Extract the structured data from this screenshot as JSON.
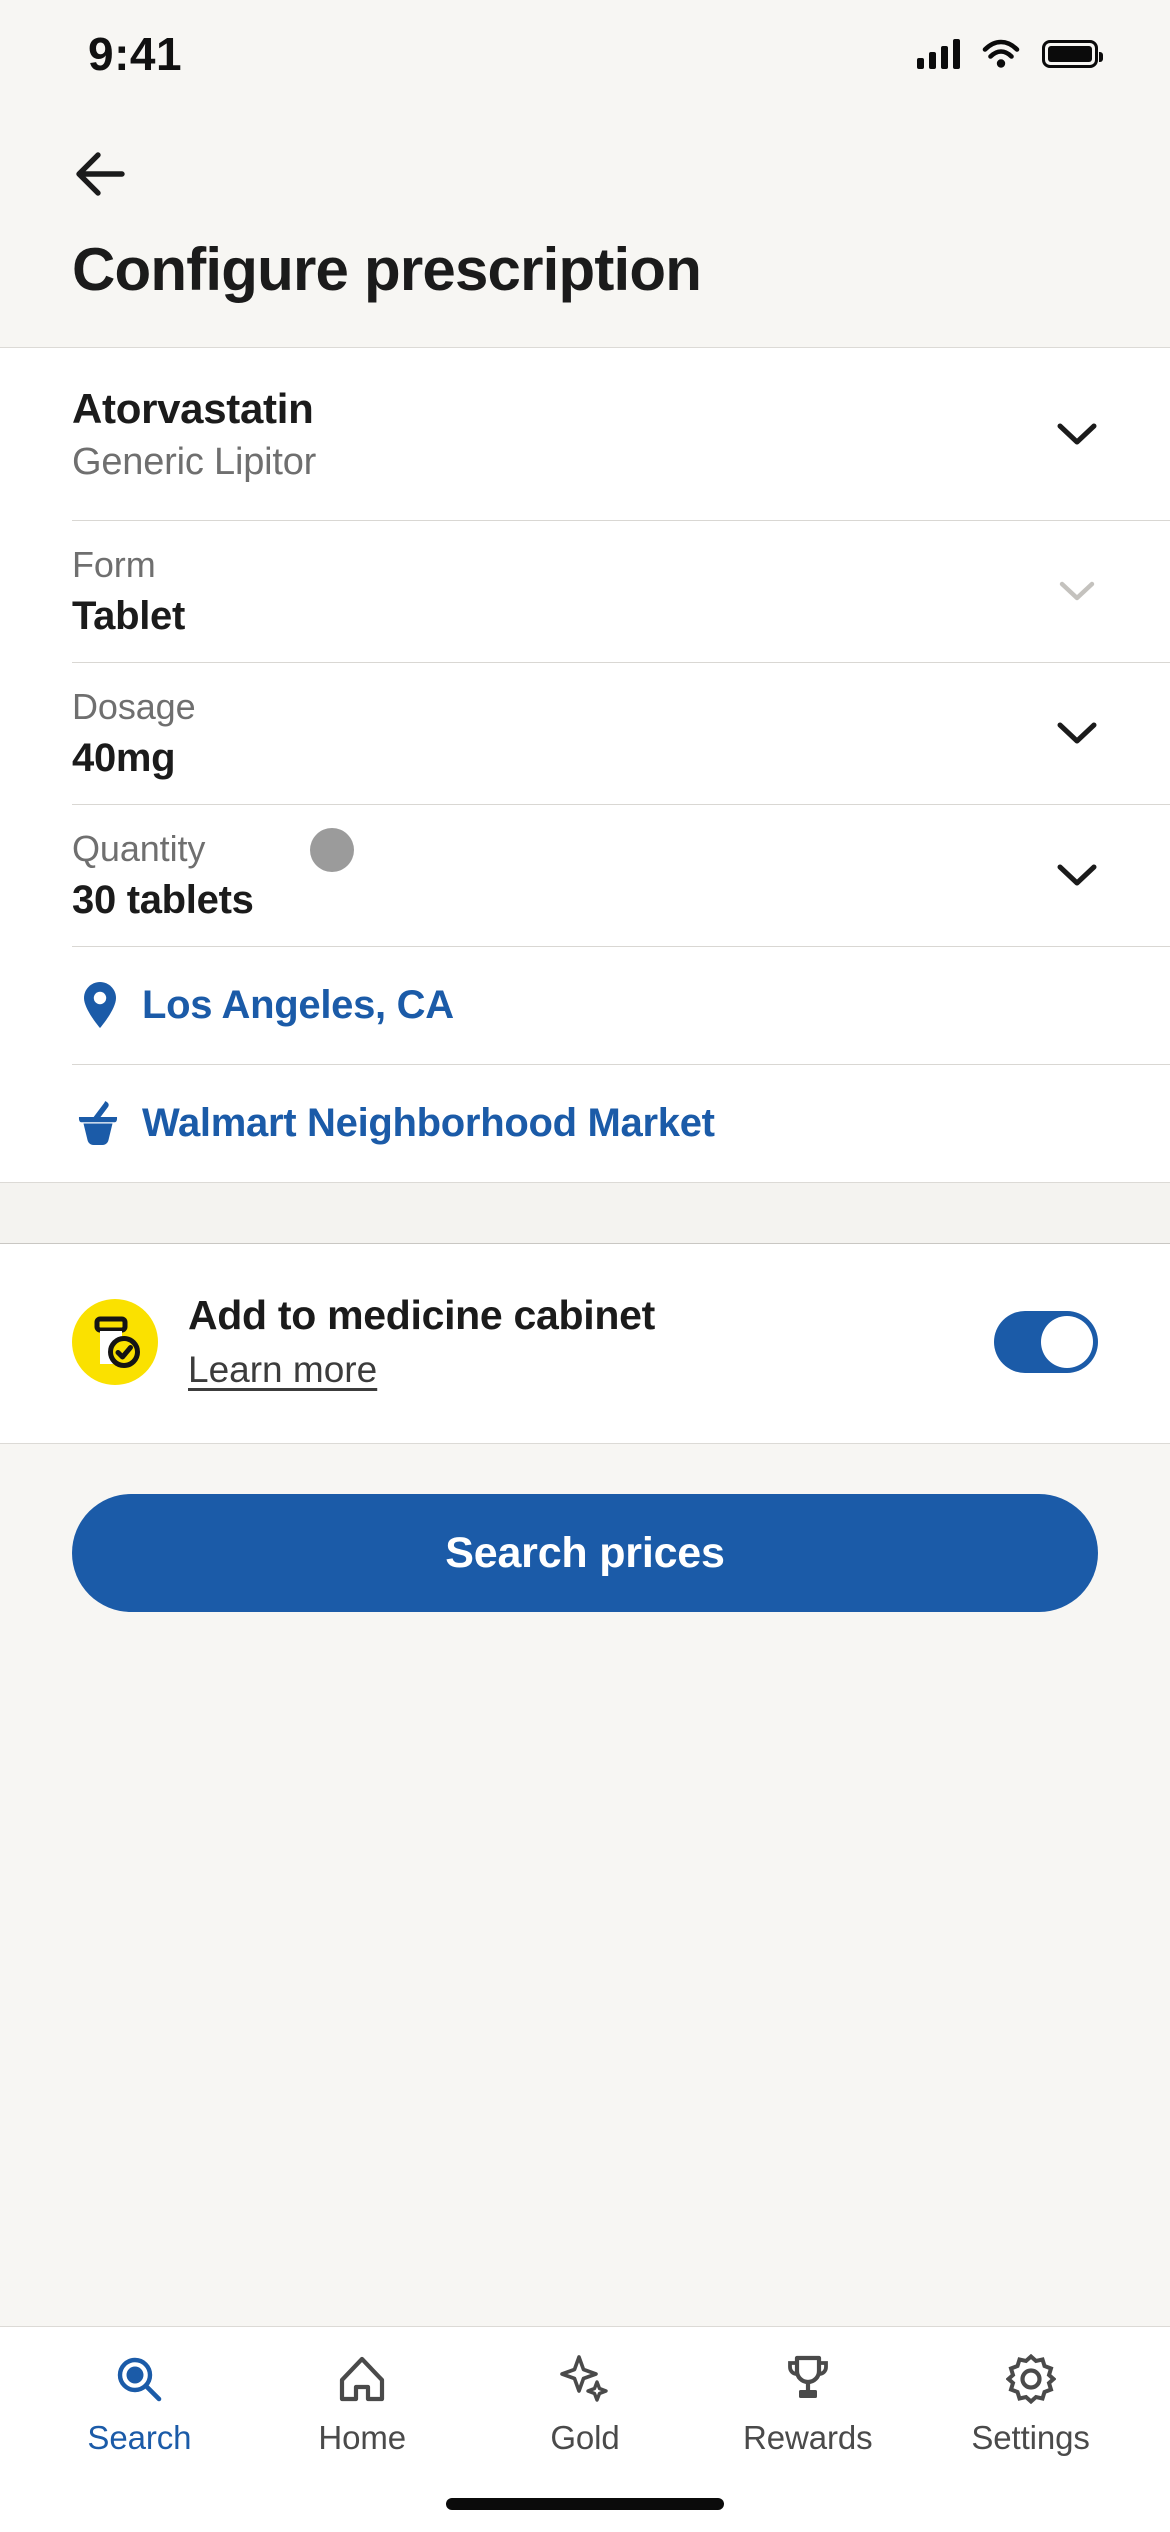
{
  "status_bar": {
    "time": "9:41",
    "cellular_icon": "signal-bars-icon",
    "wifi_icon": "wifi-icon",
    "battery_icon": "battery-full-icon"
  },
  "header": {
    "back_icon": "back-arrow-icon",
    "title": "Configure prescription"
  },
  "form": {
    "drug": {
      "name": "Atorvastatin",
      "subtitle": "Generic Lipitor",
      "chevron_icon": "chevron-down-icon"
    },
    "fields": [
      {
        "label": "Form",
        "value": "Tablet",
        "chevron_icon": "chevron-down-icon",
        "enabled": false
      },
      {
        "label": "Dosage",
        "value": "40mg",
        "chevron_icon": "chevron-down-icon",
        "enabled": true
      },
      {
        "label": "Quantity",
        "value": "30 tablets",
        "chevron_icon": "chevron-down-icon",
        "enabled": true
      }
    ],
    "location": {
      "icon": "location-pin-icon",
      "label": "Los Angeles, CA"
    },
    "pharmacy": {
      "icon": "mortar-pestle-icon",
      "label": "Walmart Neighborhood Market"
    }
  },
  "cabinet": {
    "badge_icon": "pill-bottle-check-icon",
    "title": "Add to medicine cabinet",
    "link": "Learn more",
    "toggle_name": "medicine-cabinet-toggle",
    "toggle_on": true
  },
  "cta": {
    "label": "Search prices"
  },
  "tabs": [
    {
      "label": "Search",
      "icon": "search-icon",
      "active": true
    },
    {
      "label": "Home",
      "icon": "home-icon",
      "active": false
    },
    {
      "label": "Gold",
      "icon": "sparkle-icon",
      "active": false
    },
    {
      "label": "Rewards",
      "icon": "trophy-icon",
      "active": false
    },
    {
      "label": "Settings",
      "icon": "gear-icon",
      "active": false
    }
  ],
  "colors": {
    "brand_blue": "#1B5BA8",
    "badge_yellow": "#FAE100",
    "page_background": "#F7F6F3",
    "card_background": "#FFFFFF",
    "text_primary": "#1B1B1B",
    "text_secondary": "#6F6F6F",
    "divider": "#D9D7D3",
    "cursor_dot": "#9B9B9B"
  }
}
